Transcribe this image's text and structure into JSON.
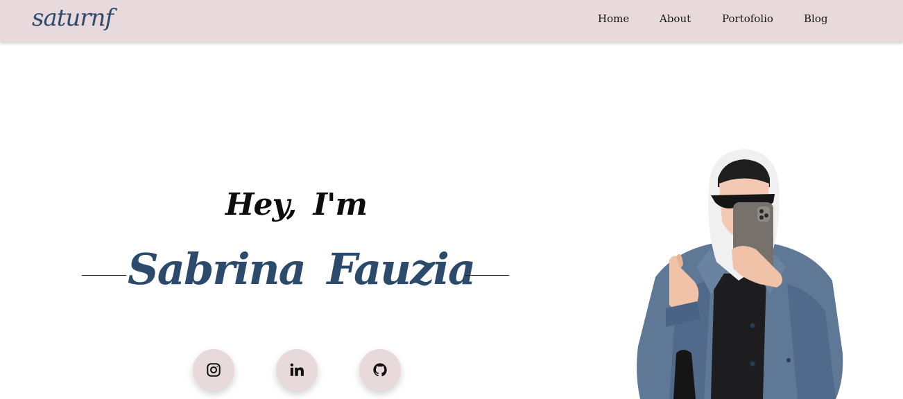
{
  "nav": {
    "logo": "saturnf",
    "links": [
      "Home",
      "About",
      "Portofolio",
      "Blog"
    ]
  },
  "hero": {
    "greeting": "Hey,  I'm",
    "name": "Sabrina  Fauzia"
  },
  "social": [
    {
      "icon": "instagram-icon"
    },
    {
      "icon": "linkedin-icon"
    },
    {
      "icon": "github-icon"
    }
  ],
  "colors": {
    "navbar_bg": "#e8dadc",
    "accent": "#2b4a6c",
    "button_bg": "#e8dadc"
  }
}
